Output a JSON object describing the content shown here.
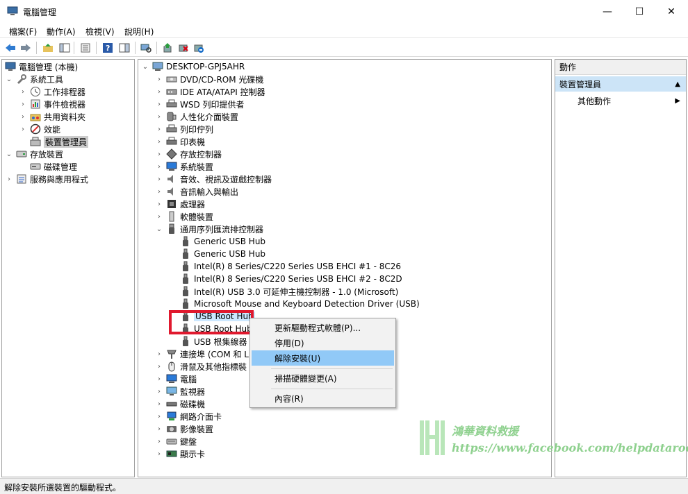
{
  "window": {
    "title": "電腦管理",
    "minimize_glyph": "—",
    "maximize_glyph": "☐",
    "close_glyph": "✕"
  },
  "menu": [
    "檔案(F)",
    "動作(A)",
    "檢視(V)",
    "說明(H)"
  ],
  "toolbar": {
    "icons": [
      "back-arrow-icon",
      "forward-arrow-icon",
      "up-folder-icon",
      "console-tree-icon",
      "properties-icon",
      "help-icon",
      "show-hide-icon",
      "scan-hardware-icon",
      "update-driver-icon",
      "disable-device-icon",
      "uninstall-device-icon"
    ]
  },
  "left_tree": {
    "root": "電腦管理 (本機)",
    "system_tools": "系統工具",
    "task_scheduler": "工作排程器",
    "event_viewer": "事件檢視器",
    "shared_folders": "共用資料夾",
    "performance": "效能",
    "device_manager": "裝置管理員",
    "storage": "存放裝置",
    "disk_management": "磁碟管理",
    "services_apps": "服務與應用程式"
  },
  "device_tree": {
    "root": "DESKTOP-GPJ5AHR",
    "categories_top": [
      "DVD/CD-ROM 光碟機",
      "IDE ATA/ATAPI 控制器",
      "WSD 列印提供者",
      "人性化介面裝置",
      "列印佇列",
      "印表機",
      "存放控制器",
      "系統裝置",
      "音效、視訊及遊戲控制器",
      "音訊輸入與輸出",
      "處理器",
      "軟體裝置"
    ],
    "usb_category": "通用序列匯流排控制器",
    "usb_children": [
      "Generic USB Hub",
      "Generic USB Hub",
      "Intel(R) 8 Series/C220 Series  USB EHCI #1 - 8C26",
      "Intel(R) 8 Series/C220 Series  USB EHCI #2 - 8C2D",
      "Intel(R) USB 3.0 可延伸主機控制器 - 1.0 (Microsoft)",
      "Microsoft Mouse and Keyboard Detection Driver (USB)",
      "USB Root Hub",
      "USB Root Hub",
      "USB 根集線器 ("
    ],
    "categories_bottom": [
      "連接埠 (COM 和 LI",
      "滑鼠及其他指標裝",
      "電腦",
      "監視器",
      "磁碟機",
      "網路介面卡",
      "影像裝置",
      "鍵盤",
      "顯示卡"
    ]
  },
  "context_menu": {
    "update": "更新驅動程式軟體(P)...",
    "disable": "停用(D)",
    "uninstall": "解除安裝(U)",
    "scan": "掃描硬體變更(A)",
    "properties": "內容(R)"
  },
  "actions": {
    "title": "動作",
    "section": "裝置管理員",
    "more": "其他動作"
  },
  "status": "解除安裝所選裝置的驅動程式。",
  "watermark": {
    "name": "鴻華資料救援",
    "url": "https://www.facebook.com/helpdataroom"
  },
  "colors": {
    "selection": "#cce8ff",
    "menu_active": "#91c9f7",
    "highlight_box": "#e0192e",
    "watermark": "#8fd18f"
  }
}
